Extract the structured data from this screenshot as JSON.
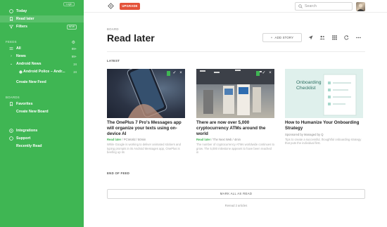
{
  "sidebar": {
    "login_label": "Login",
    "nav": [
      {
        "label": "Today",
        "icon": "today-icon"
      },
      {
        "label": "Read later",
        "icon": "bookmark-icon"
      },
      {
        "label": "Filters",
        "icon": "filter-icon",
        "badge": "NEW"
      }
    ],
    "feeds_heading": "FEEDS",
    "feeds": [
      {
        "label": "All",
        "count": "99+"
      },
      {
        "label": "News",
        "count": "99+"
      },
      {
        "label": "Android News",
        "count": "24"
      },
      {
        "label": "Android Police – Andr...",
        "count": "24"
      }
    ],
    "create_feed": "Create New Feed",
    "boards_heading": "BOARDS",
    "boards": [
      {
        "label": "Favorites"
      }
    ],
    "create_board": "Create New Board",
    "bottom": [
      {
        "label": "Integrations",
        "icon": "integrations-icon"
      },
      {
        "label": "Support",
        "icon": "support-icon"
      },
      {
        "label": "Recently Read",
        "icon": ""
      }
    ],
    "accent_color": "#3fb653"
  },
  "topbar": {
    "upgrade_label": "UPGRADE",
    "upgrade_color": "#e4533a",
    "search_placeholder": "Search"
  },
  "main": {
    "breadcrumb": "BOARD",
    "title": "Read later",
    "add_story_label": "ADD STORY",
    "latest_label": "LATEST",
    "articles": [
      {
        "title": "The OnePlus 7 Pro's Messages app will organize your texts using on-device AI",
        "source": "Read later",
        "meta": "/ PCWorld / 50min",
        "summary": "While Google is working to deliver animated stickers and typing prompts in its Android Messages app, OnePlus is beefing up its"
      },
      {
        "title": "There are now over 5,000 cryptocurrency ATMs around the world",
        "source": "Read later",
        "meta": "/ The Next Web / 4min",
        "summary": "The number of cryptocurrency ATMs worldwide continues to grow. The 5,000 milestone appears to have been reached in"
      },
      {
        "title": "How to Humanize Your Onboarding Strategy",
        "source": "",
        "meta": "Sponsored by Managed by Q",
        "summary": "Tips to create a successful, thoughtful onboarding strategy that puts the individual first.",
        "thumb_text": "Onboarding Checklist"
      }
    ],
    "end_label": "END OF FEED",
    "mark_all_label": "MARK ALL AS READ",
    "reread_label": "Reread 2 articles"
  }
}
